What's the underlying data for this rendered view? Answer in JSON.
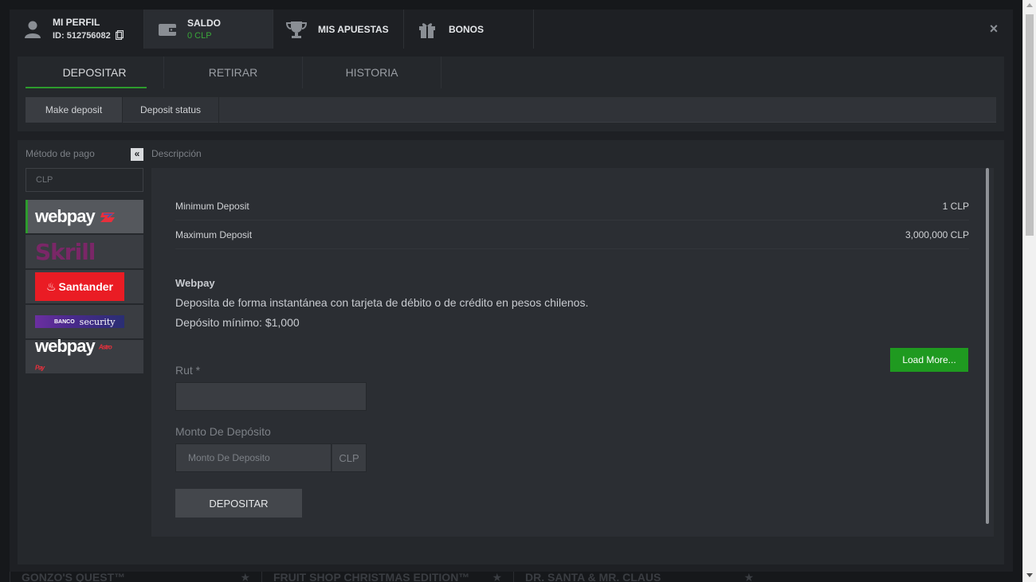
{
  "background": {
    "games": [
      {
        "name": "GONZO'S QUEST™"
      },
      {
        "name": "FRUIT SHOP CHRISTMAS EDITION™"
      },
      {
        "name": "DR. SANTA & MR. CLAUS"
      }
    ]
  },
  "header": {
    "tabs": [
      {
        "label": "MI PERFIL",
        "sub": "ID: 512756082",
        "icon": "user-icon"
      },
      {
        "label": "SALDO",
        "sub": "0 CLP",
        "icon": "wallet-icon"
      },
      {
        "label": "MIS APUESTAS",
        "icon": "trophy-icon"
      },
      {
        "label": "BONOS",
        "icon": "gift-icon"
      }
    ],
    "close": "×"
  },
  "sub_tabs": [
    "DEPOSITAR",
    "RETIRAR",
    "HISTORIA"
  ],
  "inner_tabs": [
    "Make deposit",
    "Deposit status"
  ],
  "sidebar": {
    "method_label": "Método de pago",
    "collapse": "«",
    "currency_placeholder": "CLP",
    "methods": [
      "webpay",
      "Skrill",
      "Santander",
      "security",
      "webpay"
    ]
  },
  "description_label": "Descripción",
  "limits": [
    {
      "label": "Minimum Deposit",
      "value": "1 CLP"
    },
    {
      "label": "Maximum Deposit",
      "value": "3,000,000 CLP"
    }
  ],
  "method_info": {
    "title": "Webpay",
    "line1": "Deposita de forma instantánea con tarjeta de débito o de crédito en pesos chilenos.",
    "line2": "Depósito mínimo: $1,000"
  },
  "load_more": "Load More...",
  "form": {
    "rut_label": "Rut *",
    "amount_label": "Monto De Depósito",
    "amount_placeholder": "Monto De Deposito",
    "amount_currency": "CLP",
    "submit": "DEPOSITAR"
  },
  "colors": {
    "accent": "#2d9b2d",
    "button_green": "#1f9a20"
  }
}
